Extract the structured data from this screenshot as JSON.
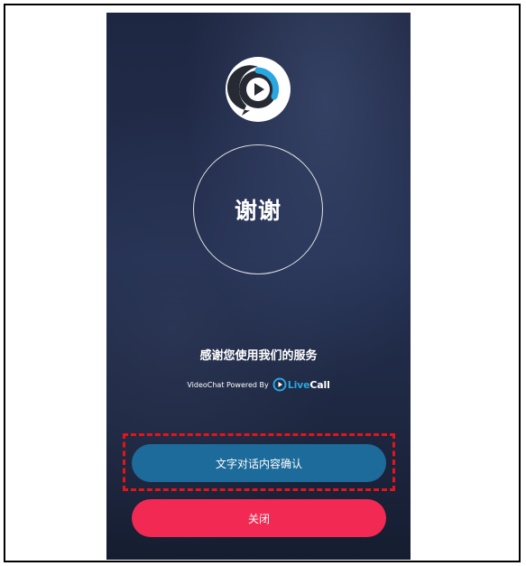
{
  "thanks_title": "谢谢",
  "thank_you_message": "感谢您使用我们的服务",
  "powered_by": {
    "text": "VideoChat Powered By",
    "brand_live": "Live",
    "brand_call": "Call"
  },
  "buttons": {
    "confirm_label": "文字对话内容确认",
    "close_label": "关闭"
  },
  "icons": {
    "app_logo": "chat-play-icon",
    "brand_logo": "livecall-logo-icon"
  },
  "colors": {
    "background_top": "#1e2741",
    "background_bottom": "#151d30",
    "confirm_button": "#1d6b9a",
    "close_button": "#f22a53",
    "brand_accent": "#2aa6e0",
    "highlight": "#e4141b"
  }
}
